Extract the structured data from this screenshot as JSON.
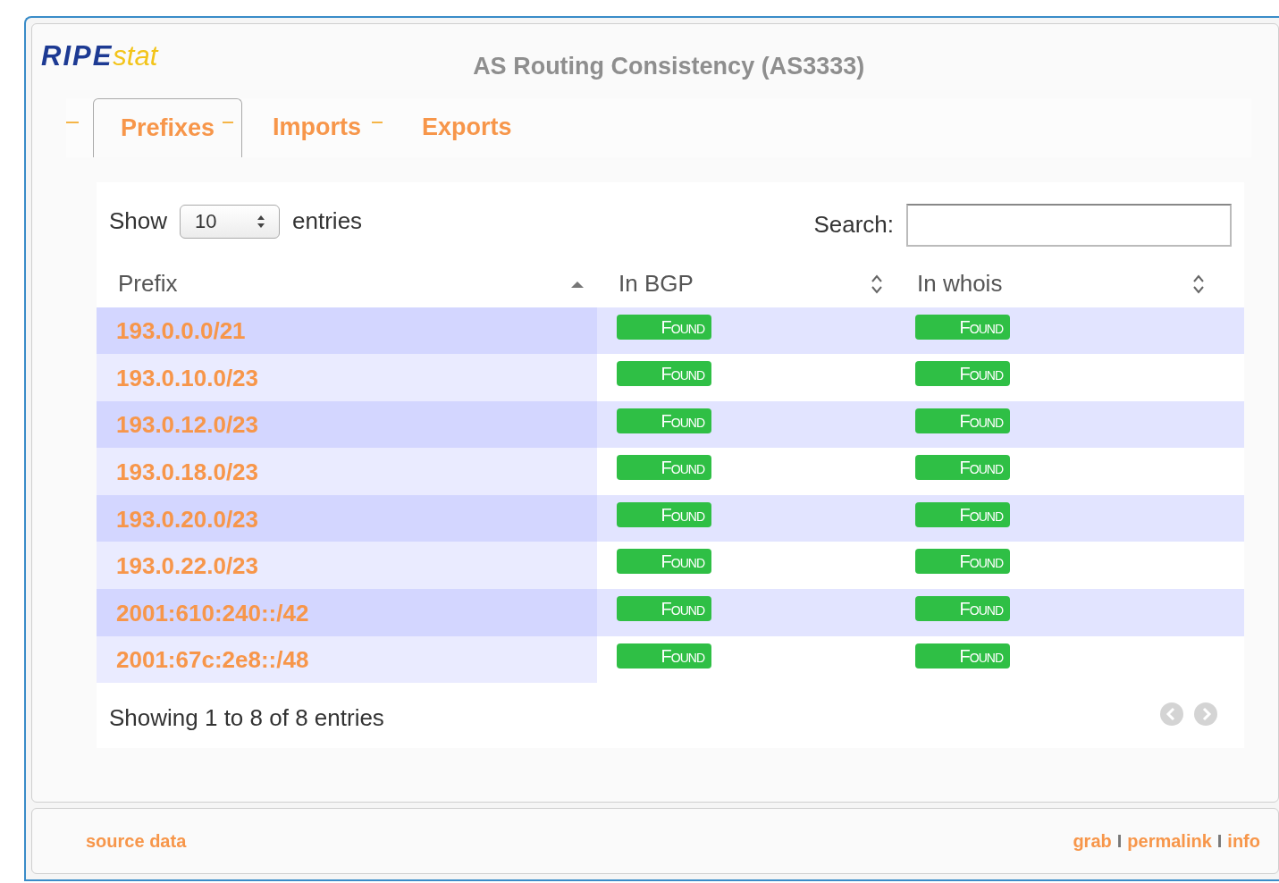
{
  "logo": {
    "part_1": "RIPE",
    "part_2": "stat"
  },
  "title": "AS Routing Consistency (AS3333)",
  "tabs": [
    {
      "label": "Prefixes",
      "selected": true
    },
    {
      "label": "Imports",
      "selected": false
    },
    {
      "label": "Exports",
      "selected": false
    }
  ],
  "length_control": {
    "prefix": "Show",
    "value": "10",
    "suffix": "entries"
  },
  "search": {
    "label": "Search:"
  },
  "table": {
    "columns": [
      {
        "label": "Prefix",
        "sorted": true
      },
      {
        "label": "In BGP",
        "sorted": false
      },
      {
        "label": "In whois",
        "sorted": false
      }
    ],
    "rows": [
      {
        "prefix": "193.0.0.0/21",
        "in_bgp": "Found",
        "in_whois": "Found"
      },
      {
        "prefix": "193.0.10.0/23",
        "in_bgp": "Found",
        "in_whois": "Found"
      },
      {
        "prefix": "193.0.12.0/23",
        "in_bgp": "Found",
        "in_whois": "Found"
      },
      {
        "prefix": "193.0.18.0/23",
        "in_bgp": "Found",
        "in_whois": "Found"
      },
      {
        "prefix": "193.0.20.0/23",
        "in_bgp": "Found",
        "in_whois": "Found"
      },
      {
        "prefix": "193.0.22.0/23",
        "in_bgp": "Found",
        "in_whois": "Found"
      },
      {
        "prefix": "2001:610:240::/42",
        "in_bgp": "Found",
        "in_whois": "Found"
      },
      {
        "prefix": "2001:67c:2e8::/48",
        "in_bgp": "Found",
        "in_whois": "Found"
      }
    ]
  },
  "info": "Showing 1 to 8 of 8 entries",
  "footer": {
    "left": "source data",
    "links": [
      "grab",
      "permalink",
      "info"
    ],
    "separators": [
      "I",
      "I"
    ]
  }
}
